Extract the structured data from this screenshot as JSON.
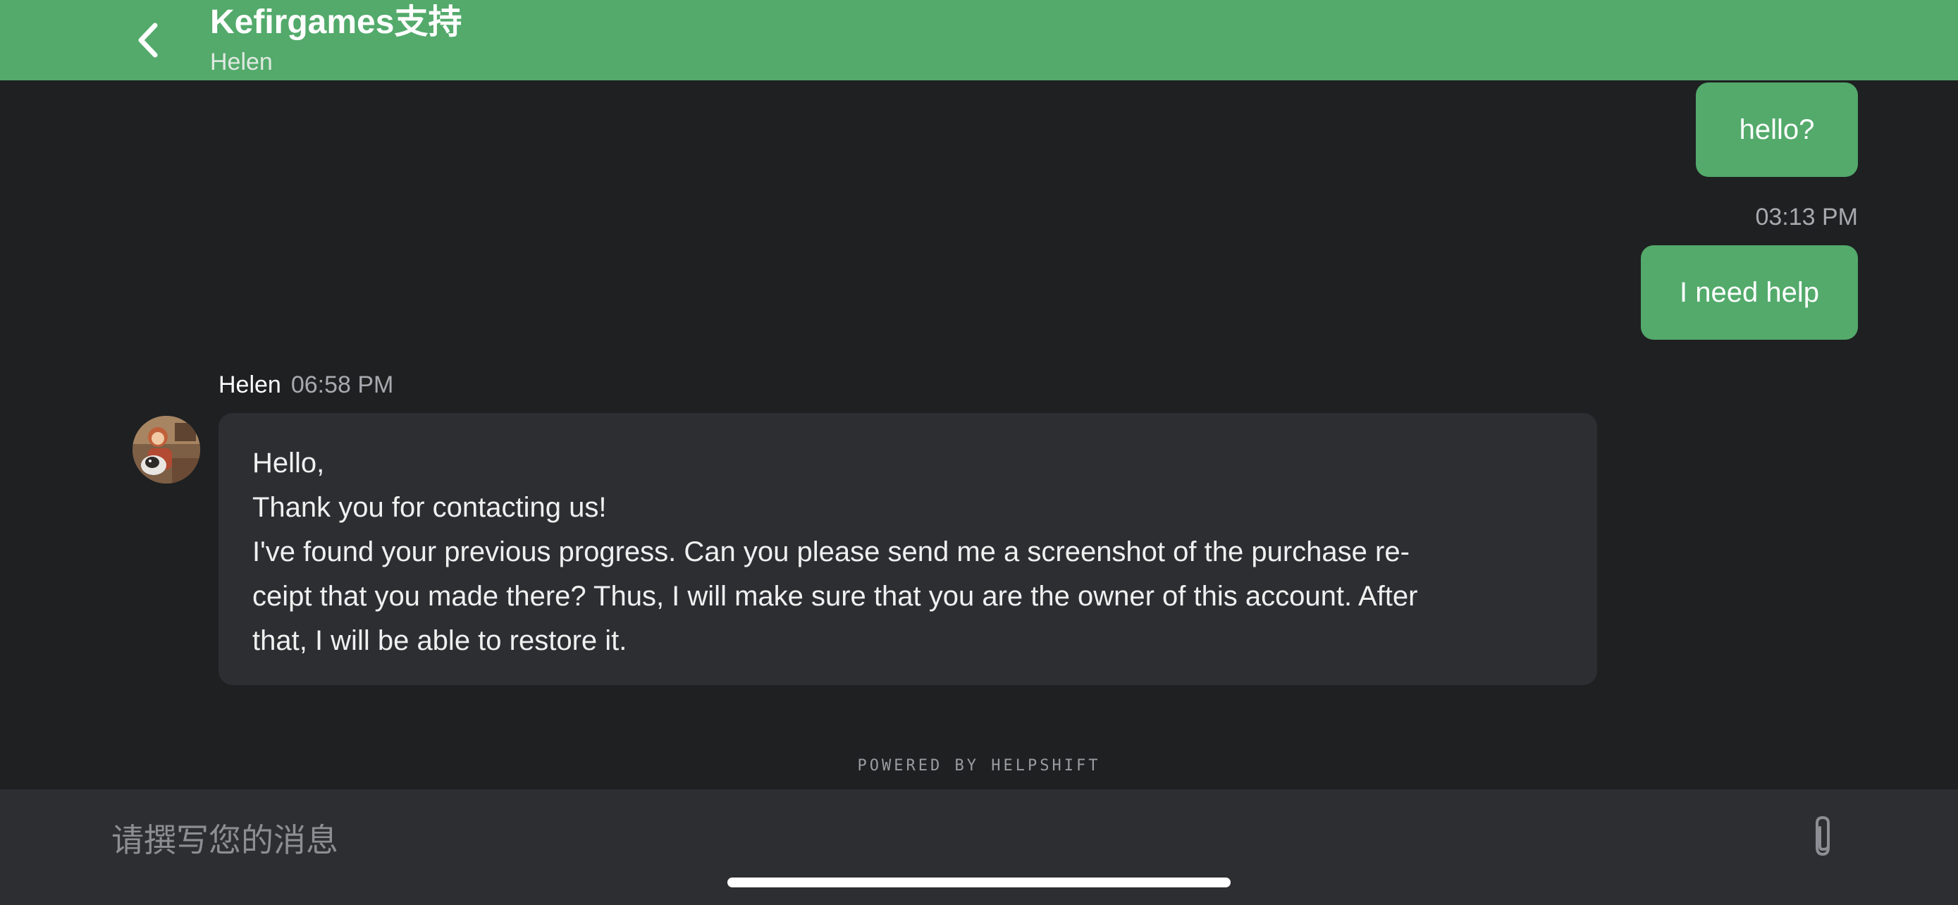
{
  "header": {
    "title": "Kefirgames支持",
    "subtitle": "Helen",
    "back_icon": "chevron-left-icon",
    "background_color": "#53aa6b"
  },
  "messages": {
    "outgoing": [
      {
        "text": "hello?"
      },
      {
        "text": "I need help",
        "time": "03:13 PM"
      }
    ],
    "incoming": {
      "sender": "Helen",
      "time": "06:58 PM",
      "lines": [
        "Hello,",
        "Thank you for contacting us!",
        "I've found your previous progress. Can you please send me a screenshot of the purchase re-",
        "ceipt that you made there? Thus, I will make sure that you are the owner of this account. After",
        "that, I will be able to restore it."
      ]
    }
  },
  "footer": {
    "powered_by": "POWERED BY HELPSHIFT"
  },
  "composer": {
    "placeholder": "请撰写您的消息",
    "value": "",
    "attach_icon": "paperclip-icon"
  },
  "colors": {
    "accent": "#53aa6b",
    "background": "#1f2022",
    "bubble_incoming": "#2d2e32"
  }
}
